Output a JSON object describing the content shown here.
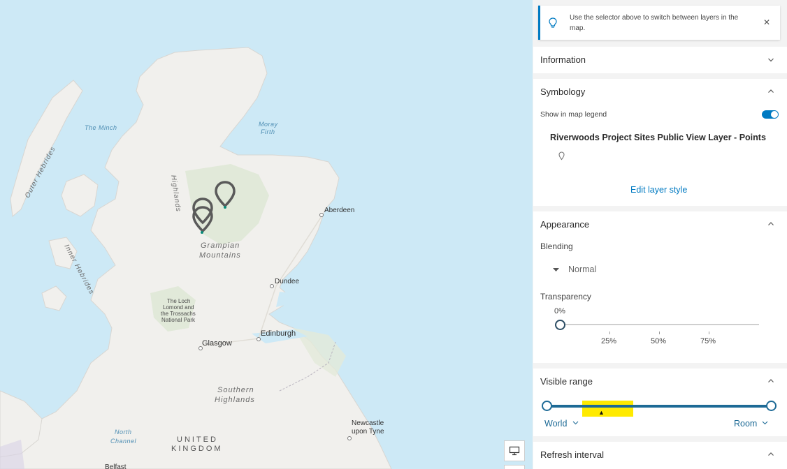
{
  "map": {
    "water_labels": {
      "the_minch": "The Minch",
      "moray_firth_1": "Moray",
      "moray_firth_2": "Firth",
      "north_channel_1": "North",
      "north_channel_2": "Channel"
    },
    "region_labels": {
      "outer_hebrides": "Outer Hebrides",
      "highlands": "Highlands",
      "inner_hebrides": "Inner Hebrides",
      "grampian_1": "Grampian",
      "grampian_2": "Mountains",
      "southern_1": "Southern",
      "southern_2": "Highlands",
      "uk_1": "UNITED",
      "uk_2": "KINGDOM"
    },
    "park_label": {
      "line1": "The Loch",
      "line2": "Lomond and",
      "line3": "the Trossachs",
      "line4": "National Park"
    },
    "cities": {
      "aberdeen": "Aberdeen",
      "dundee": "Dundee",
      "edinburgh": "Edinburgh",
      "glasgow": "Glasgow",
      "newcastle_1": "Newcastle",
      "newcastle_2": "upon Tyne",
      "belfast": "Belfast"
    }
  },
  "panel": {
    "notice_text": "Use the selector above to switch between layers in the map.",
    "information": {
      "title": "Information"
    },
    "symbology": {
      "title": "Symbology",
      "show_legend_label": "Show in map legend",
      "show_legend_on": true,
      "layer_title": "Riverwoods Project Sites Public View Layer - Points",
      "edit_style_link": "Edit layer style"
    },
    "appearance": {
      "title": "Appearance",
      "blending_label": "Blending",
      "blending_value": "Normal",
      "transparency_label": "Transparency",
      "transparency_value": "0%",
      "ticks": [
        "25%",
        "50%",
        "75%"
      ]
    },
    "visible_range": {
      "title": "Visible range",
      "min_label": "World",
      "max_label": "Room"
    },
    "refresh": {
      "title": "Refresh interval"
    }
  },
  "colors": {
    "accent": "#007ac2",
    "range": "#1d6a96",
    "highlight": "#ffea00"
  }
}
